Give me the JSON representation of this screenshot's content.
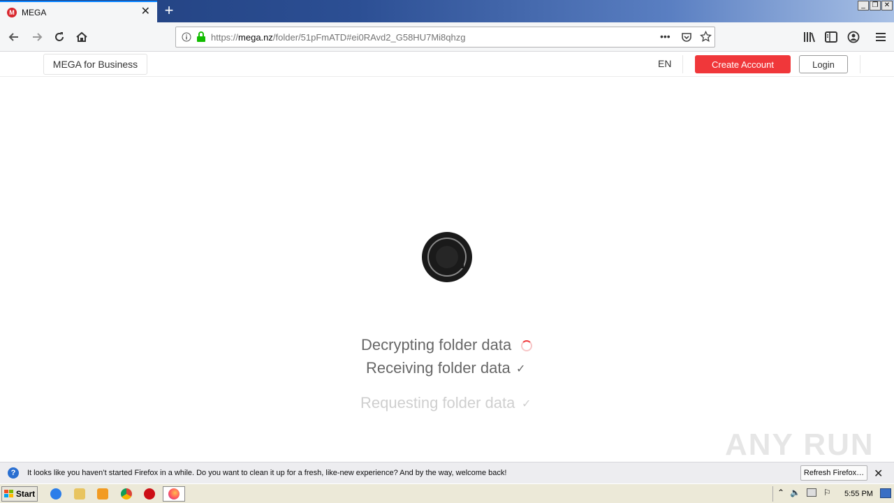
{
  "browser": {
    "tab_title": "MEGA",
    "favicon_letter": "M",
    "new_tab_symbol": "+",
    "url_prefix": "https://",
    "url_host": "mega.nz",
    "url_path": "/folder/51pFmATD#ei0RAvd2_G58HU7Mi8qhzg",
    "page_actions": "•••"
  },
  "window_controls": {
    "minimize": "_",
    "maximize": "❐",
    "close": "✕"
  },
  "site_header": {
    "business_label": "MEGA for Business",
    "lang": "EN",
    "create_account_label": "Create Account",
    "login_label": "Login",
    "accent": "#f0373a"
  },
  "loading": {
    "steps": [
      {
        "label": "Decrypting folder data",
        "state": "in-progress"
      },
      {
        "label": "Receiving folder data",
        "state": "done"
      },
      {
        "label": "Requesting folder data",
        "state": "done"
      }
    ],
    "check_glyph": "✓"
  },
  "watermark": "ANY RUN",
  "notification": {
    "icon": "?",
    "message": "It looks like you haven’t started Firefox in a while. Do you want to clean it up for a fresh, like-new experience? And by the way, welcome back!",
    "refresh_label": "Refresh Firefox…",
    "close_glyph": "✕"
  },
  "taskbar": {
    "start_label": "Start",
    "clock": "5:55 PM",
    "icons": [
      "ie-icon",
      "explorer-icon",
      "media-player-icon",
      "chrome-icon",
      "opera-icon",
      "firefox-icon"
    ]
  }
}
